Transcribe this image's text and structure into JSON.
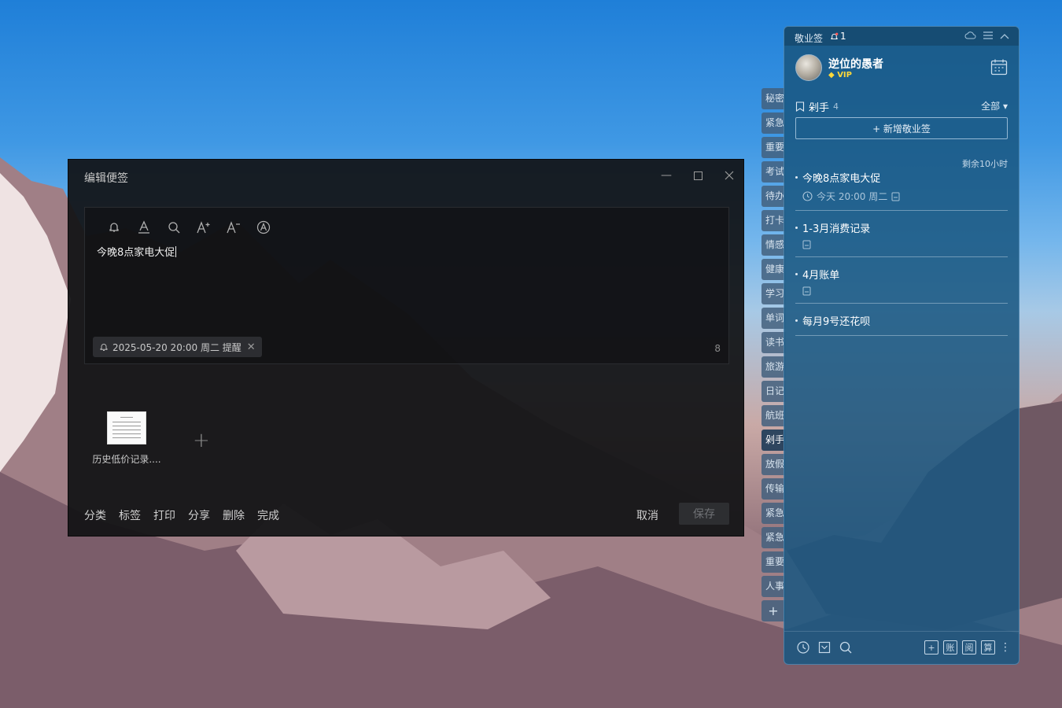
{
  "editor": {
    "title": "编辑便签",
    "note_text": "今晚8点家电大促",
    "reminder": "2025-05-20 20:00 周二 提醒",
    "char_count": "8",
    "attachment_name": "历史低价记录....",
    "footer": {
      "category": "分类",
      "tag": "标签",
      "print": "打印",
      "share": "分享",
      "delete": "删除",
      "done": "完成"
    },
    "cancel": "取消",
    "save": "保存"
  },
  "categories": [
    "秘密",
    "紧急",
    "重要",
    "考试",
    "待办",
    "打卡",
    "情感",
    "健康",
    "学习",
    "单词",
    "读书",
    "旅游",
    "日记",
    "航班",
    "剁手",
    "放假",
    "传输",
    "紧急",
    "紧急",
    "重要",
    "人事"
  ],
  "category_add": "+",
  "panel": {
    "app_name": "敬业签",
    "notification_count": "1",
    "username": "逆位的愚者",
    "vip_label": "VIP",
    "group_name": "剁手",
    "group_count": "4",
    "filter": "全部",
    "new_note": "+ 新增敬业签",
    "remaining": "剩余10小时",
    "notes": [
      {
        "title": "今晚8点家电大促",
        "meta": "今天 20:00 周二"
      },
      {
        "title": "1-3月消费记录",
        "meta": ""
      },
      {
        "title": "4月账单",
        "meta": ""
      },
      {
        "title": "每月9号还花呗",
        "meta": ""
      }
    ],
    "bottom_right": [
      "+",
      "账",
      "阅",
      "算"
    ]
  }
}
